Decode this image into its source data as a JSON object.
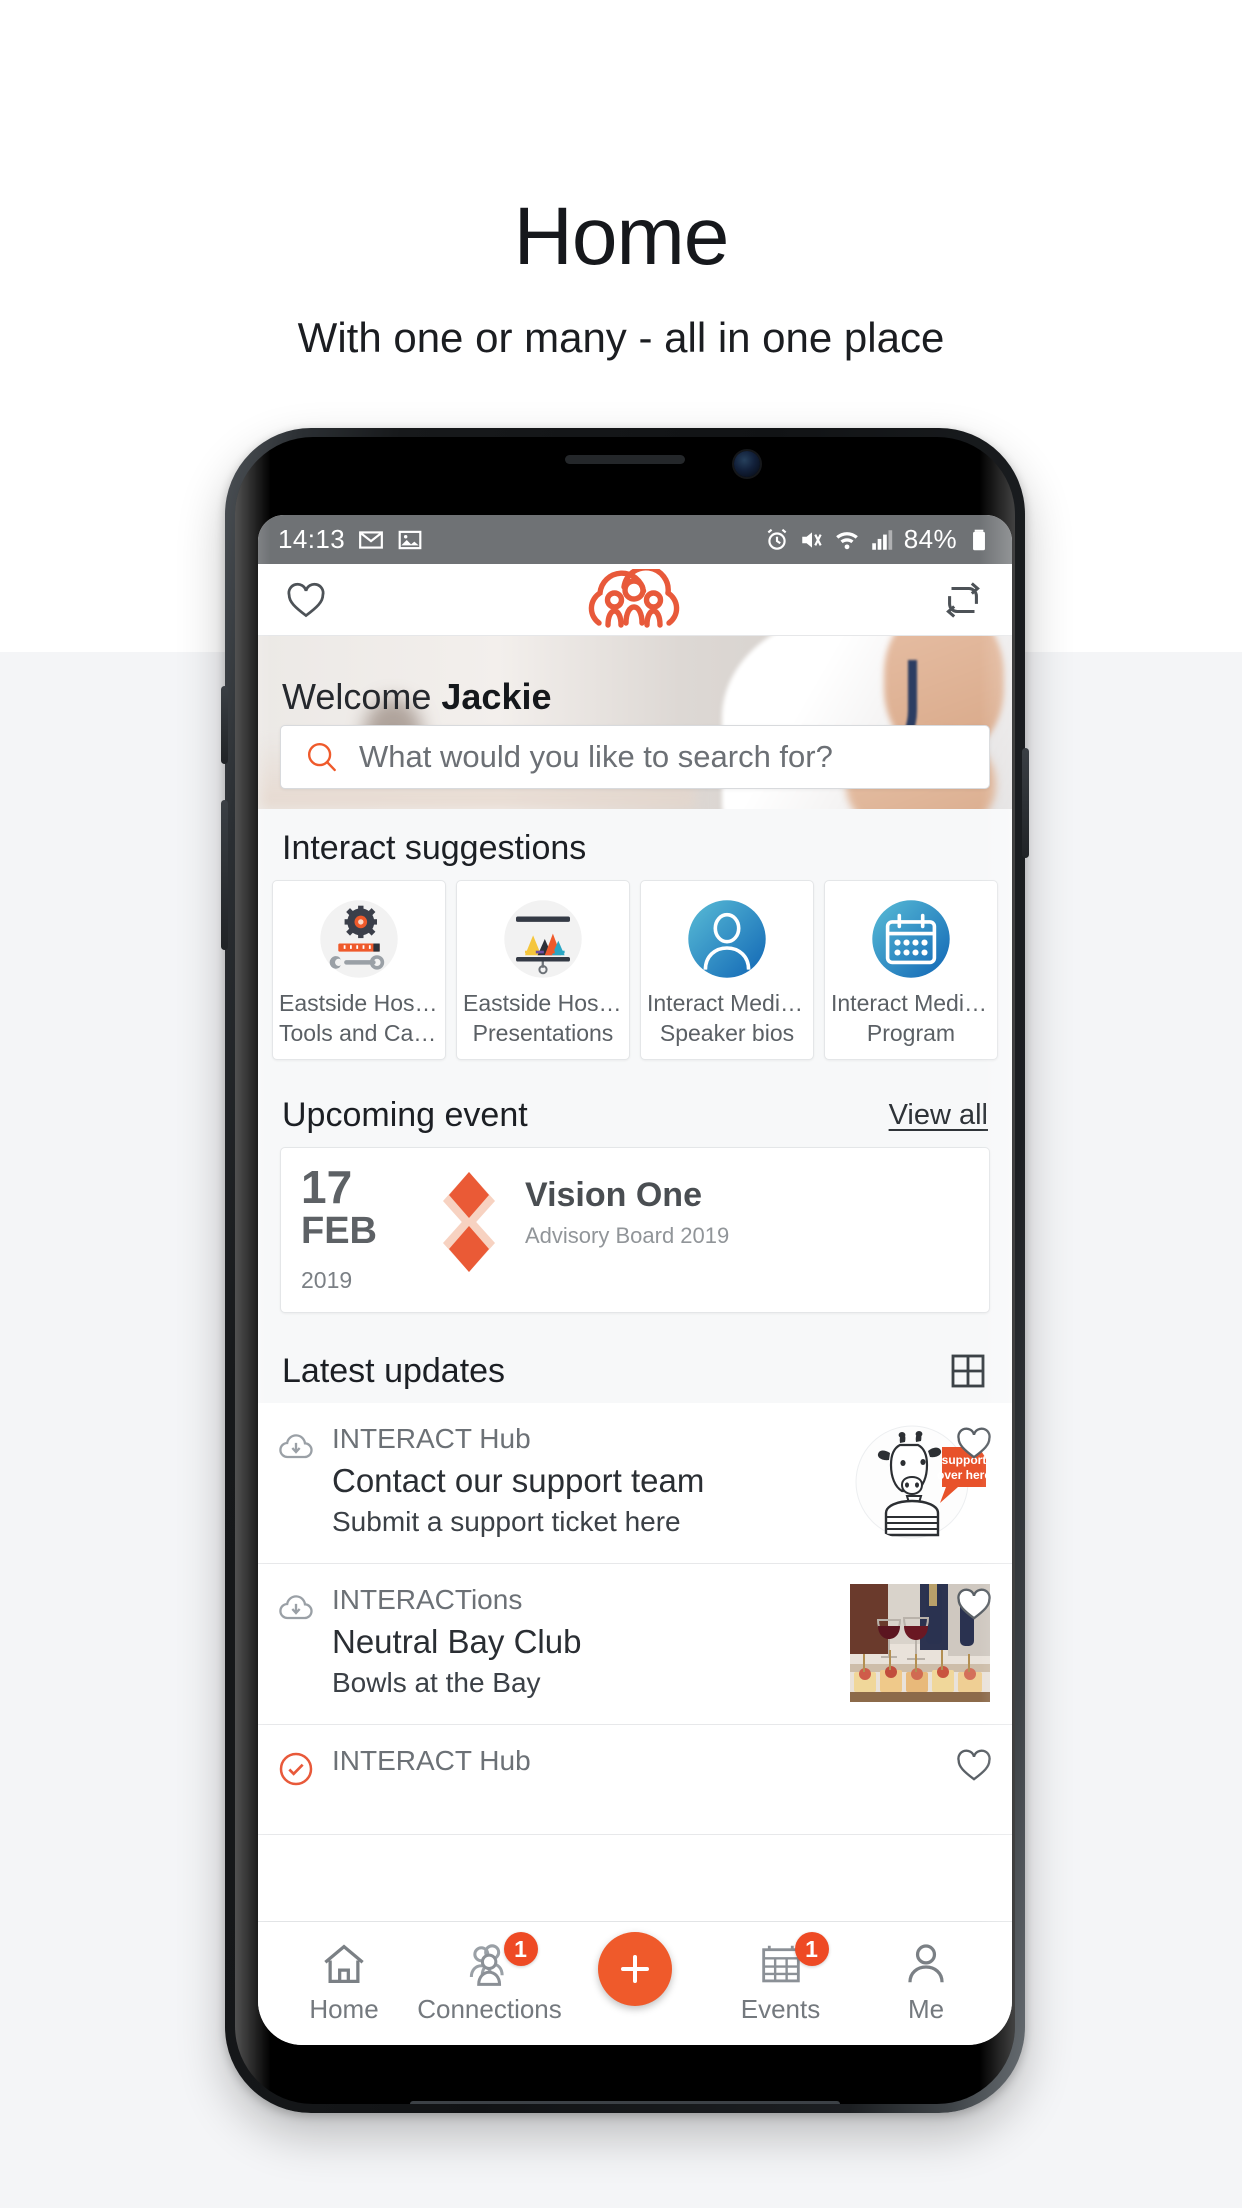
{
  "promo": {
    "title": "Home",
    "subtitle": "With one or many - all in one place"
  },
  "colors": {
    "brand_orange": "#ef5a2b",
    "badge_red": "#ee4a24",
    "status_bar_gray": "#6f7275",
    "page_bg": "#f4f5f7"
  },
  "status_bar": {
    "time": "14:13",
    "left_icons": [
      "gmail-icon",
      "photos-icon"
    ],
    "right_icons": [
      "alarm-icon",
      "mute-icon",
      "wifi-icon",
      "signal-icon"
    ],
    "battery_percent": "84%",
    "battery_icon": "battery-icon"
  },
  "appbar": {
    "favorites_icon": "heart-icon",
    "logo_icon": "people-group-logo",
    "sync_icon": "refresh-icon"
  },
  "hero": {
    "welcome_prefix": "Welcome ",
    "user_name": "Jackie"
  },
  "search": {
    "icon": "search-icon",
    "placeholder": "What would you like to search for?",
    "value": ""
  },
  "suggestions": {
    "title": "Interact suggestions",
    "cards": [
      {
        "icon": "tools-calculator-icon",
        "line1": "Eastside Hosp…",
        "line2": "Tools and Calcu…"
      },
      {
        "icon": "presentation-chart-icon",
        "line1": "Eastside Hosp…",
        "line2": "Presentations"
      },
      {
        "icon": "person-avatar-icon",
        "line1": "Interact Medic…",
        "line2": "Speaker bios"
      },
      {
        "icon": "calendar-icon",
        "line1": "Interact Medic…",
        "line2": "Program"
      }
    ]
  },
  "upcoming_event": {
    "title": "Upcoming event",
    "view_all_label": "View all",
    "day": "17",
    "month": "FEB",
    "year": "2019",
    "logo_icon": "vision-one-diamond-logo",
    "name": "Vision One",
    "subtitle": "Advisory Board 2019"
  },
  "latest_updates": {
    "title": "Latest updates",
    "layout_toggle_icon": "grid-view-icon",
    "items": [
      {
        "status_icon": "cloud-download-icon",
        "source": "INTERACT Hub",
        "title": "Contact our support team",
        "description": "Submit a support ticket here",
        "thumbnail": "giraffe-support-illustration",
        "thumbnail_badge_text": "support\nover here",
        "favorite_icon": "heart-icon"
      },
      {
        "status_icon": "cloud-download-icon",
        "source": "INTERACTions",
        "title": "Neutral Bay Club",
        "description": "Bowls at the Bay",
        "thumbnail": "wine-and-canapes-photo",
        "favorite_icon": "heart-icon"
      },
      {
        "status_icon": "check-circle-icon",
        "source": "INTERACT Hub",
        "title": "",
        "description": "",
        "favorite_icon": "heart-icon"
      }
    ]
  },
  "bottom_nav": {
    "items": [
      {
        "icon": "home-icon",
        "label": "Home",
        "badge": ""
      },
      {
        "icon": "connections-icon",
        "label": "Connections",
        "badge": "1"
      },
      {
        "icon": "plus-icon",
        "label": "",
        "badge": ""
      },
      {
        "icon": "events-calendar-icon",
        "label": "Events",
        "badge": "1"
      },
      {
        "icon": "person-icon",
        "label": "Me",
        "badge": ""
      }
    ]
  }
}
